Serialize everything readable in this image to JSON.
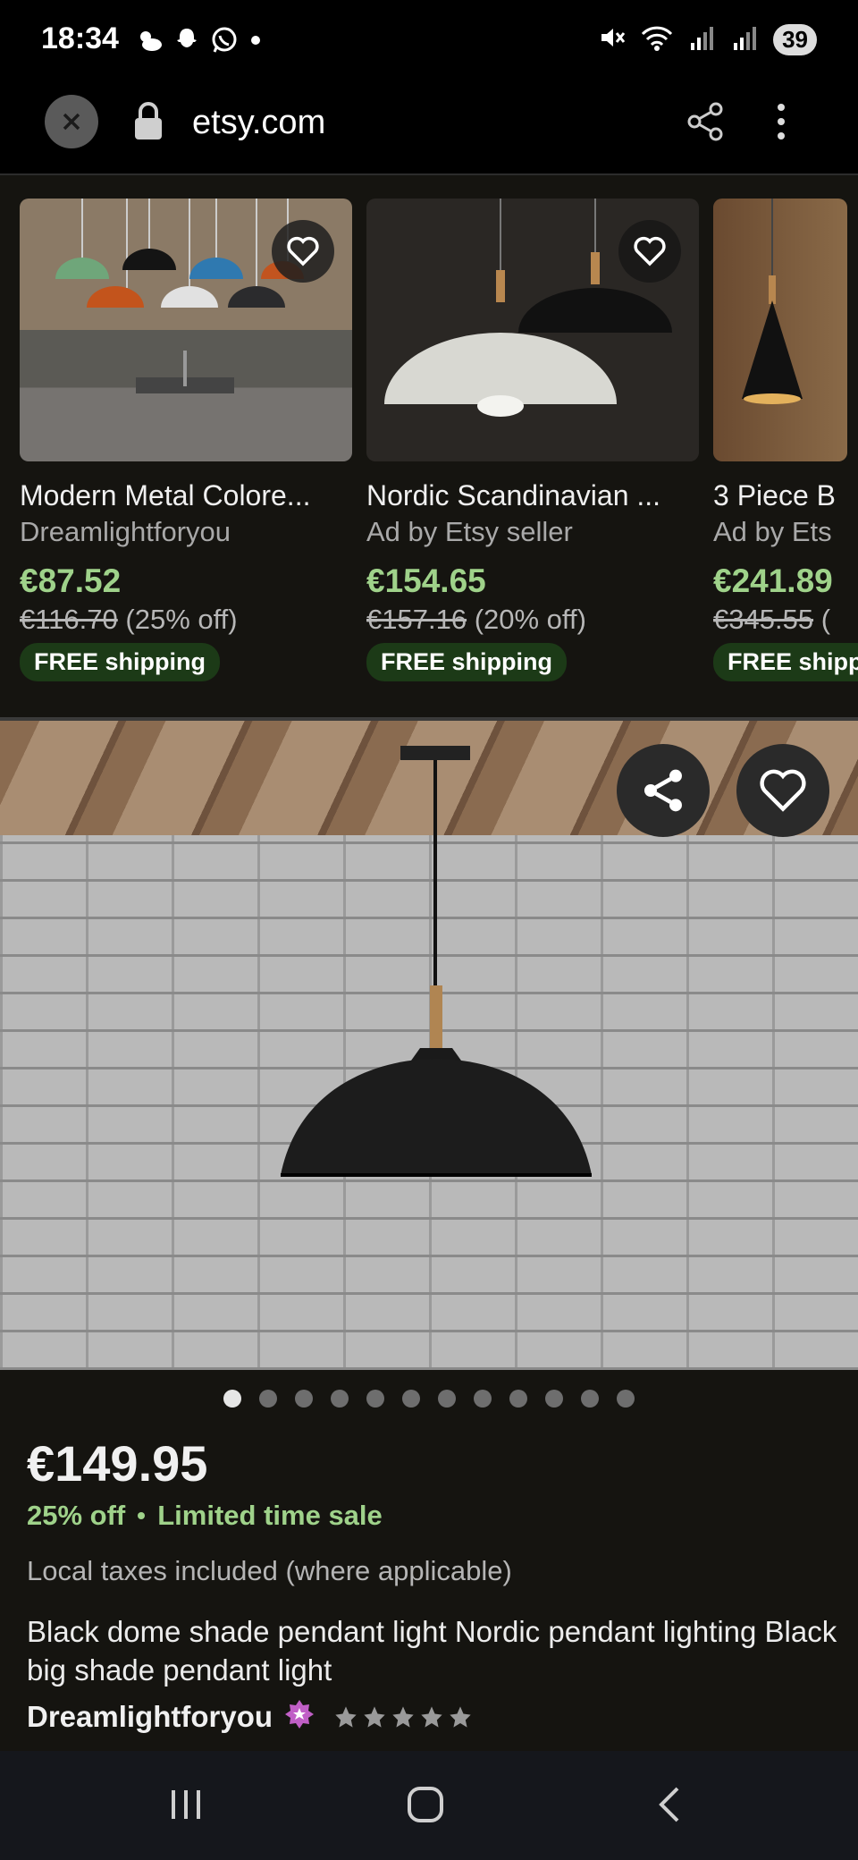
{
  "status_bar": {
    "time": "18:34",
    "battery": "39",
    "left_icons": [
      "weather-icon",
      "snapchat-icon",
      "whatsapp-icon",
      "dot-icon"
    ],
    "right_icons": [
      "mute-icon",
      "wifi-icon",
      "signal-icon",
      "signal-icon"
    ]
  },
  "browser": {
    "url": "etsy.com"
  },
  "recommendations": [
    {
      "title": "Modern Metal Colore...",
      "shop": "Dreamlightforyou",
      "price": "€87.52",
      "original_price": "€116.70",
      "discount": "(25% off)",
      "shipping": "FREE shipping"
    },
    {
      "title": "Nordic Scandinavian ...",
      "shop": "Ad by Etsy seller",
      "price": "€154.65",
      "original_price": "€157.16",
      "discount": "(20% off)",
      "shipping": "FREE shipping"
    },
    {
      "title": "3 Piece B",
      "shop": "Ad by Ets",
      "price": "€241.89",
      "original_price": "€345.55",
      "discount": "(",
      "shipping": "FREE shipp"
    }
  ],
  "product": {
    "image_count": 12,
    "active_image": 0,
    "price": "€149.95",
    "discount": "25% off",
    "sale_label": "Limited time sale",
    "taxes_note": "Local taxes included (where applicable)",
    "title": "Black dome shade pendant light Nordic pendant lighting Black big shade pendant light",
    "seller": "Dreamlightforyou",
    "rating": 5
  },
  "colors": {
    "sale_green": "#9fd28a",
    "shipping_badge": "#1c3a17",
    "star_seller_badge": "#c05fc6",
    "background": "#151410"
  }
}
